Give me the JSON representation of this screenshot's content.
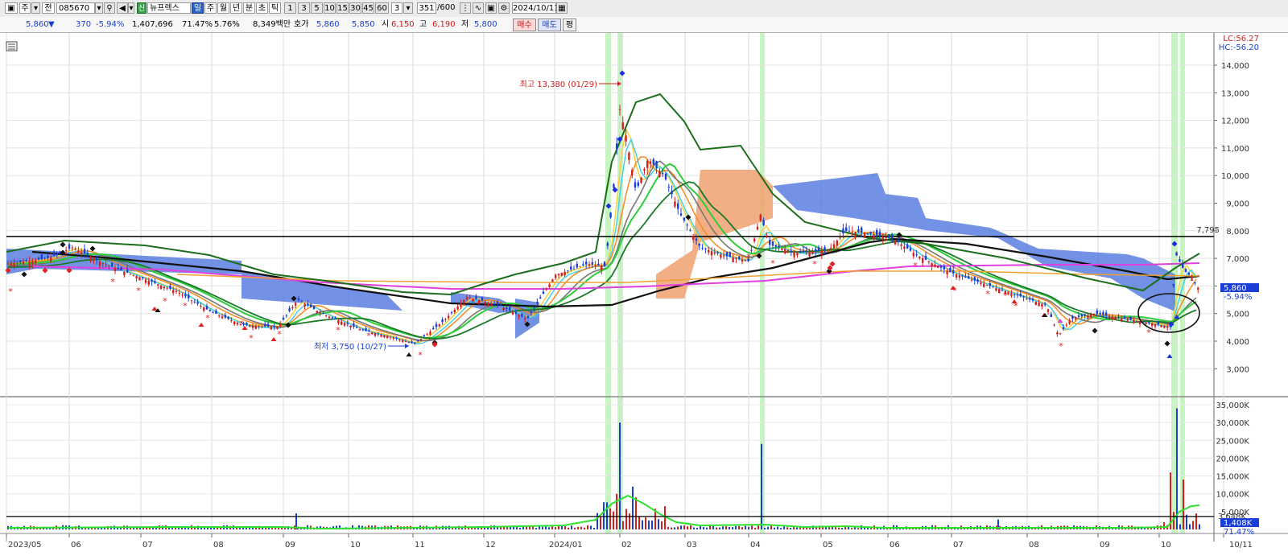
{
  "toolbar": {
    "tab_period_label": "주",
    "tab_all_label": "전",
    "code": "085670",
    "credit_badge": "신",
    "name": "뉴프렉스",
    "periods": [
      "일",
      "주",
      "월",
      "년",
      "분",
      "초",
      "틱"
    ],
    "active_period": "일",
    "minute_values": [
      "1",
      "3",
      "5",
      "10",
      "15",
      "30",
      "45",
      "60"
    ],
    "minute_selected": "3",
    "count": "351",
    "count_total": "/600",
    "date": "2024/10/11"
  },
  "info": {
    "price": "5,860",
    "price_arrow": "▼",
    "change": "370",
    "change_pct": "-5.94%",
    "volume": "1,407,696",
    "volume_pct": "71.47%",
    "turnover": "5.76%",
    "amount": "8,349백만",
    "bid_label": "호가",
    "bid1": "5,860",
    "bid2": "5,850",
    "open_label": "시",
    "open": "6,150",
    "high_label": "고",
    "high": "6,190",
    "low_label": "저",
    "low": "5,800",
    "buy_label": "매수",
    "sell_label": "매도",
    "flat_label": "평"
  },
  "price_panel": {
    "lc_label": "LC:56.27",
    "hc_label": "HC:-56.20",
    "y_ticks": [
      "14,000",
      "13,000",
      "12,000",
      "11,000",
      "10,000",
      "9,000",
      "8,000",
      "7,000",
      "6,000",
      "5,000",
      "4,000",
      "3,000"
    ],
    "hline_value": "7,795",
    "cur_price": "5,860",
    "cur_pct": "-5.94%",
    "high_annotation": "최고 13,380 (01/29)",
    "low_annotation": "최저 3,750 (10/27)"
  },
  "volume_panel": {
    "y_ticks": [
      "35,000K",
      "30,000K",
      "25,000K",
      "20,000K",
      "15,000K",
      "10,000K",
      "5,000K"
    ],
    "hline_value": "3,648K",
    "cur_volume": "1,408K",
    "cur_volume_pct": "71.47%"
  },
  "x_axis": {
    "labels": [
      "2023/05",
      "06",
      "07",
      "08",
      "09",
      "10",
      "11",
      "12",
      "2024/01",
      "02",
      "03",
      "04",
      "05",
      "06",
      "07",
      "08",
      "09",
      "10",
      "10/11"
    ]
  },
  "colors": {
    "up": "#d42020",
    "down": "#1a3fd8",
    "cloud_blue": "#5a7ee0",
    "cloud_orange": "#f0a070",
    "highlight_band": "#aef0a8"
  }
}
